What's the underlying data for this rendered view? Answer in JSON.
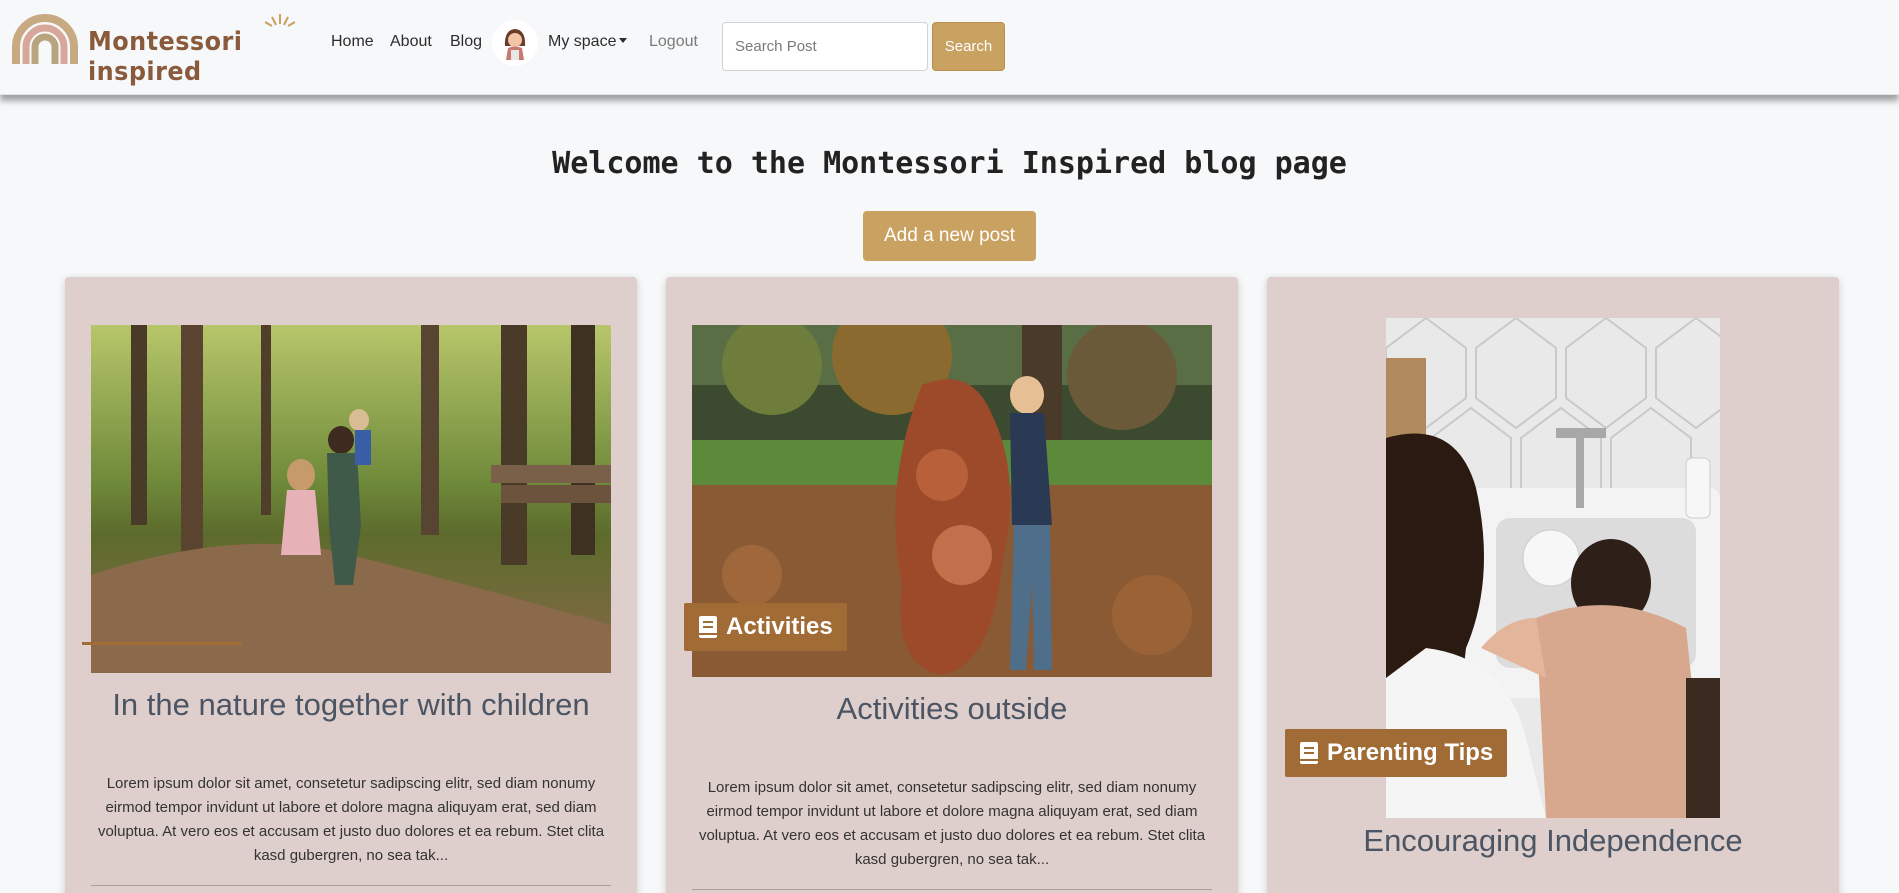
{
  "nav": {
    "brand": "Montessori inspired",
    "links": [
      "Home",
      "About",
      "Blog"
    ],
    "my_space": "My space",
    "logout": "Logout",
    "search_placeholder": "Search Post",
    "search_button": "Search"
  },
  "hero": {
    "title": "Welcome to the Montessori Inspired blog page",
    "add_post": "Add a new post"
  },
  "posts": [
    {
      "title": "In the nature together with children",
      "excerpt": "Lorem ipsum dolor sit amet, consetetur sadipscing elitr, sed diam nonumy eirmod tempor invidunt ut labore et dolore magna aliquyam erat, sed diam voluptua. At vero eos et accusam et justo duo dolores et ea rebum. Stet clita kasd gubergren, no sea tak...",
      "category": ""
    },
    {
      "title": "Activities outside",
      "excerpt": "Lorem ipsum dolor sit amet, consetetur sadipscing elitr, sed diam nonumy eirmod tempor invidunt ut labore et dolore magna aliquyam erat, sed diam voluptua. At vero eos et accusam et justo duo dolores et ea rebum. Stet clita kasd gubergren, no sea tak...",
      "category": "Activities"
    },
    {
      "title": "Encouraging Independence",
      "excerpt": "",
      "category": "Parenting Tips"
    }
  ],
  "colors": {
    "accent": "#c9a160",
    "tag": "#a06b35",
    "card_bg": "#dfcfcc",
    "brand_text": "#8a5a3c"
  },
  "icons": [
    "rainbow-logo-icon",
    "sun-rays-icon",
    "user-avatar-icon",
    "caret-down-icon",
    "book-icon"
  ]
}
